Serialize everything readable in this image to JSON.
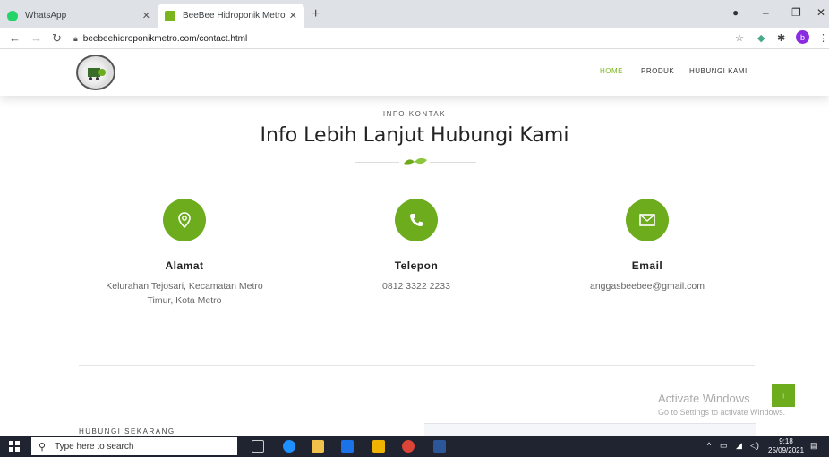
{
  "browser": {
    "tabs": [
      {
        "title": "WhatsApp",
        "active": false
      },
      {
        "title": "BeeBee Hidroponik Metro",
        "active": true
      }
    ],
    "url": "beebeehidroponikmetro.com/contact.html",
    "profile_initial": "b"
  },
  "site": {
    "nav": [
      {
        "label": "HOME",
        "active": true
      },
      {
        "label": "PRODUK",
        "active": false
      },
      {
        "label": "HUBUNGI KAMI",
        "active": false
      }
    ],
    "kicker": "INFO KONTAK",
    "title": "Info Lebih Lanjut Hubungi Kami",
    "contacts": [
      {
        "icon": "map-pin-icon",
        "heading": "Alamat",
        "text_line1": "Kelurahan Tejosari, Kecamatan Metro",
        "text_line2": "Timur, Kota Metro"
      },
      {
        "icon": "phone-icon",
        "heading": "Telepon",
        "text_line1": "0812 3322 2233",
        "text_line2": ""
      },
      {
        "icon": "envelope-icon",
        "heading": "Email",
        "text_line1": "anggasbeebee@gmail.com",
        "text_line2": ""
      }
    ],
    "cta_kicker": "HUBUNGI SEKARANG",
    "back_to_top": "↑",
    "accent_color": "#6cac1d"
  },
  "windows_watermark": {
    "line1": "Activate Windows",
    "line2": "Go to Settings to activate Windows."
  },
  "taskbar": {
    "search_placeholder": "Type here to search",
    "time": "9:18",
    "date": "25/09/2021"
  }
}
